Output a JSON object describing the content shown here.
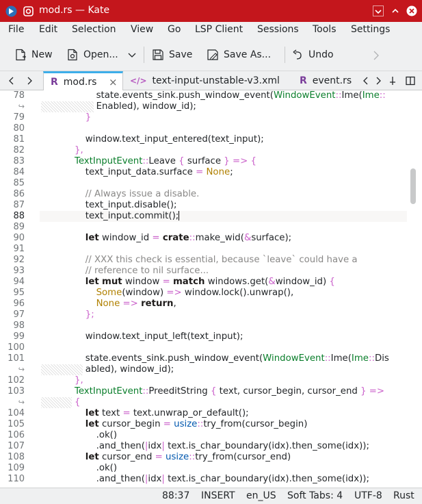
{
  "window": {
    "title": "mod.rs — Kate",
    "accent": "#c4161c"
  },
  "menu": [
    "File",
    "Edit",
    "Selection",
    "View",
    "Go",
    "LSP Client",
    "Sessions",
    "Tools",
    "Settings"
  ],
  "toolbar": {
    "new_label": "New",
    "open_label": "Open...",
    "save_label": "Save",
    "save_as_label": "Save As...",
    "undo_label": "Undo"
  },
  "tabs": [
    {
      "label": "mod.rs",
      "icon": "rust-icon",
      "active": true
    },
    {
      "label": "text-input-unstable-v3.xml",
      "icon": "xml-icon",
      "active": false
    },
    {
      "label": "event.rs",
      "icon": "rust-icon",
      "active": false
    }
  ],
  "editor": {
    "current_line": 88,
    "wrap_marker": "↪",
    "lines": [
      {
        "n": "78",
        "indent": 5,
        "tokens": [
          [
            "state.events_sink.push_window_event(",
            ""
          ],
          [
            "WindowEvent",
            "en"
          ],
          [
            "::",
            "op"
          ],
          [
            "Ime(",
            ""
          ],
          [
            "Ime",
            "en"
          ],
          [
            "::",
            "op"
          ]
        ]
      },
      {
        "n": "↪",
        "indent": 5,
        "hatch": true,
        "tokens": [
          [
            "Enabled), window_id);",
            ""
          ]
        ]
      },
      {
        "n": "79",
        "indent": 4,
        "tokens": [
          [
            "}",
            "op"
          ]
        ]
      },
      {
        "n": "80",
        "indent": 0,
        "tokens": []
      },
      {
        "n": "81",
        "indent": 4,
        "tokens": [
          [
            "window.text_input_entered(text_input);",
            ""
          ]
        ]
      },
      {
        "n": "82",
        "indent": 3,
        "tokens": [
          [
            "},",
            "op"
          ]
        ]
      },
      {
        "n": "83",
        "indent": 3,
        "tokens": [
          [
            "TextInputEvent",
            "en"
          ],
          [
            "::",
            "op"
          ],
          [
            "Leave ",
            ""
          ],
          [
            "{",
            "op"
          ],
          [
            " surface ",
            ""
          ],
          [
            "}",
            "op"
          ],
          [
            " ",
            ""
          ],
          [
            "=>",
            "op"
          ],
          [
            " ",
            ""
          ],
          [
            "{",
            "op"
          ]
        ]
      },
      {
        "n": "84",
        "indent": 4,
        "tokens": [
          [
            "text_input_data.surface ",
            ""
          ],
          [
            "=",
            "op"
          ],
          [
            " ",
            ""
          ],
          [
            "None",
            "vl"
          ],
          [
            ";",
            ""
          ]
        ]
      },
      {
        "n": "85",
        "indent": 0,
        "tokens": []
      },
      {
        "n": "86",
        "indent": 4,
        "tokens": [
          [
            "// Always issue a disable.",
            "cm"
          ]
        ]
      },
      {
        "n": "87",
        "indent": 4,
        "tokens": [
          [
            "text_input.disable();",
            ""
          ]
        ]
      },
      {
        "n": "88",
        "indent": 4,
        "caret": true,
        "tokens": [
          [
            "text_input.commit();",
            ""
          ]
        ]
      },
      {
        "n": "89",
        "indent": 0,
        "tokens": []
      },
      {
        "n": "90",
        "indent": 4,
        "tokens": [
          [
            "let",
            "kw"
          ],
          [
            " window_id ",
            ""
          ],
          [
            "=",
            "op"
          ],
          [
            " ",
            ""
          ],
          [
            "crate",
            "kw"
          ],
          [
            "::",
            "op"
          ],
          [
            "make_wid(",
            ""
          ],
          [
            "&",
            "op"
          ],
          [
            "surface);",
            ""
          ]
        ]
      },
      {
        "n": "91",
        "indent": 0,
        "tokens": []
      },
      {
        "n": "92",
        "indent": 4,
        "tokens": [
          [
            "// XXX this check is essential, because `leave` could have a",
            "cm"
          ]
        ]
      },
      {
        "n": "93",
        "indent": 4,
        "tokens": [
          [
            "// reference to nil surface...",
            "cm"
          ]
        ]
      },
      {
        "n": "94",
        "indent": 4,
        "tokens": [
          [
            "let",
            "kw"
          ],
          [
            " ",
            ""
          ],
          [
            "mut",
            "kw"
          ],
          [
            " window ",
            ""
          ],
          [
            "=",
            "op"
          ],
          [
            " ",
            ""
          ],
          [
            "match",
            "kw"
          ],
          [
            " windows.get(",
            ""
          ],
          [
            "&",
            "op"
          ],
          [
            "window_id) ",
            ""
          ],
          [
            "{",
            "op"
          ]
        ]
      },
      {
        "n": "95",
        "indent": 5,
        "tokens": [
          [
            "Some",
            "vl"
          ],
          [
            "(window) ",
            ""
          ],
          [
            "=>",
            "op"
          ],
          [
            " window.lock().unwrap(),",
            ""
          ]
        ]
      },
      {
        "n": "96",
        "indent": 5,
        "tokens": [
          [
            "None",
            "vl"
          ],
          [
            " ",
            ""
          ],
          [
            "=>",
            "op"
          ],
          [
            " ",
            ""
          ],
          [
            "return",
            "kw"
          ],
          [
            ",",
            ""
          ]
        ]
      },
      {
        "n": "97",
        "indent": 4,
        "tokens": [
          [
            "};",
            "op"
          ]
        ]
      },
      {
        "n": "98",
        "indent": 0,
        "tokens": []
      },
      {
        "n": "99",
        "indent": 4,
        "tokens": [
          [
            "window.text_input_left(text_input);",
            ""
          ]
        ]
      },
      {
        "n": "100",
        "indent": 0,
        "tokens": []
      },
      {
        "n": "101",
        "indent": 4,
        "tokens": [
          [
            "state.events_sink.push_window_event(",
            ""
          ],
          [
            "WindowEvent",
            "en"
          ],
          [
            "::",
            "op"
          ],
          [
            "Ime(",
            ""
          ],
          [
            "Ime",
            "en"
          ],
          [
            "::",
            "op"
          ],
          [
            "Dis",
            ""
          ]
        ]
      },
      {
        "n": "↪",
        "indent": 4,
        "hatch": true,
        "tokens": [
          [
            "abled), window_id);",
            ""
          ]
        ]
      },
      {
        "n": "102",
        "indent": 3,
        "tokens": [
          [
            "},",
            "op"
          ]
        ]
      },
      {
        "n": "103",
        "indent": 3,
        "tokens": [
          [
            "TextInputEvent",
            "en"
          ],
          [
            "::",
            "op"
          ],
          [
            "PreeditString ",
            ""
          ],
          [
            "{",
            "op"
          ],
          [
            " text, cursor_begin, cursor_end ",
            ""
          ],
          [
            "}",
            "op"
          ],
          [
            " ",
            ""
          ],
          [
            "=>",
            "op"
          ]
        ]
      },
      {
        "n": "↪",
        "indent": 3,
        "hatch": true,
        "tokens": [
          [
            "{",
            "op"
          ]
        ]
      },
      {
        "n": "104",
        "indent": 4,
        "tokens": [
          [
            "let",
            "kw"
          ],
          [
            " text ",
            ""
          ],
          [
            "=",
            "op"
          ],
          [
            " text.unwrap_or_default();",
            ""
          ]
        ]
      },
      {
        "n": "105",
        "indent": 4,
        "tokens": [
          [
            "let",
            "kw"
          ],
          [
            " cursor_begin ",
            ""
          ],
          [
            "=",
            "op"
          ],
          [
            " ",
            ""
          ],
          [
            "usize",
            "ty"
          ],
          [
            "::",
            "op"
          ],
          [
            "try_from(cursor_begin)",
            ""
          ]
        ]
      },
      {
        "n": "106",
        "indent": 5,
        "tokens": [
          [
            ".ok()",
            ""
          ]
        ]
      },
      {
        "n": "107",
        "indent": 5,
        "tokens": [
          [
            ".and_then(",
            ""
          ],
          [
            "|",
            "op"
          ],
          [
            "idx",
            ""
          ],
          [
            "|",
            "op"
          ],
          [
            " text.is_char_boundary(idx).then_some(idx));",
            ""
          ]
        ]
      },
      {
        "n": "108",
        "indent": 4,
        "tokens": [
          [
            "let",
            "kw"
          ],
          [
            " cursor_end ",
            ""
          ],
          [
            "=",
            "op"
          ],
          [
            " ",
            ""
          ],
          [
            "usize",
            "ty"
          ],
          [
            "::",
            "op"
          ],
          [
            "try_from(cursor_end)",
            ""
          ]
        ]
      },
      {
        "n": "109",
        "indent": 5,
        "tokens": [
          [
            ".ok()",
            ""
          ]
        ]
      },
      {
        "n": "110",
        "indent": 5,
        "tokens": [
          [
            ".and_then(",
            ""
          ],
          [
            "|",
            "op"
          ],
          [
            "idx",
            ""
          ],
          [
            "|",
            "op"
          ],
          [
            " text.is_char_boundary(idx).then_some(idx));",
            ""
          ]
        ]
      }
    ]
  },
  "status": {
    "position": "88:37",
    "mode": "INSERT",
    "language": "en_US",
    "indent": "Soft Tabs: 4",
    "encoding": "UTF-8",
    "syntax": "Rust"
  }
}
